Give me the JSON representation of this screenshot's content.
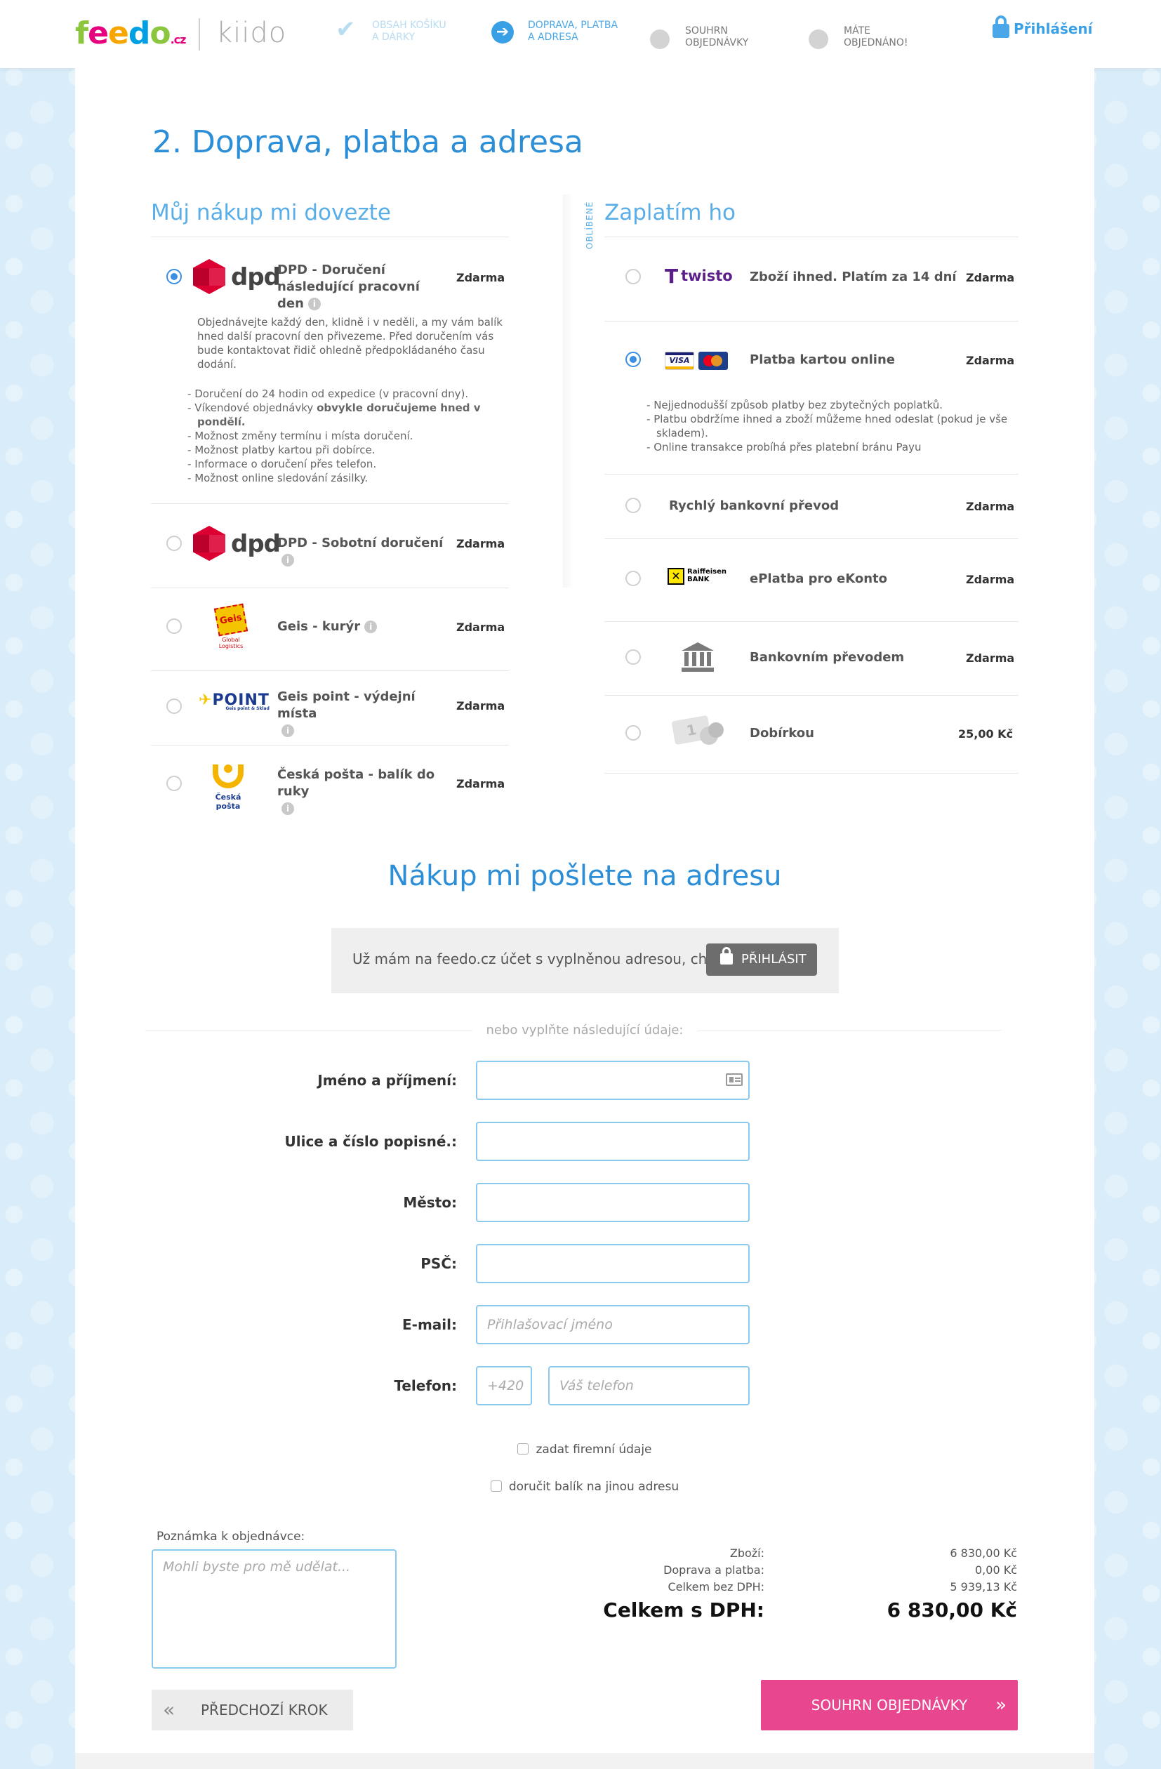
{
  "header": {
    "logo": "feedo.cz",
    "logo_secondary": "kiido",
    "steps": [
      {
        "label_line1": "OBSAH KOŠÍKU",
        "label_line2": "A DÁRKY",
        "state": "done"
      },
      {
        "label_line1": "DOPRAVA, PLATBA",
        "label_line2": "A ADRESA",
        "state": "active"
      },
      {
        "label_line1": "SOUHRN",
        "label_line2": "OBJEDNÁVKY",
        "state": "pending"
      },
      {
        "label_line1": "MÁTE",
        "label_line2": "OBJEDNÁNO!",
        "state": "pending"
      }
    ],
    "login_label": "Přihlášení"
  },
  "page": {
    "title": "2. Doprava, platba a adresa"
  },
  "delivery": {
    "title": "Můj nákup mi dovezte",
    "options": [
      {
        "logo": "dpd",
        "name": "DPD - Doručení následující pracovní den",
        "price": "Zdarma",
        "selected": true,
        "description": "Objednávejte každý den, klidně i v neděli, a my vám balík hned další pracovní den přivezeme. Před doručením vás bude kontaktovat řidič ohledně předpokládaného času dodání.",
        "bullets": [
          "Doručení do 24 hodin od expedice (v pracovní dny).",
          "Víkendové objednávky",
          "obvykle doručujeme hned v pondělí.",
          "Možnost změny termínu i místa doručení.",
          "Možnost platby kartou při dobírce.",
          "Informace o doručení přes telefon.",
          "Možnost online sledování zásilky."
        ]
      },
      {
        "logo": "dpd",
        "name": "DPD - Sobotní doručení",
        "price": "Zdarma",
        "selected": false
      },
      {
        "logo": "Geis",
        "logo_sub": "Global Logistics",
        "name": "Geis - kurýr",
        "price": "Zdarma",
        "selected": false
      },
      {
        "logo": "POINT",
        "logo_sub": "Geis point & Sklad",
        "name": "Geis point - výdejní místa",
        "price": "Zdarma",
        "selected": false
      },
      {
        "logo": "Česká pošta",
        "name": "Česká pošta - balík do ruky",
        "price": "Zdarma",
        "selected": false
      }
    ]
  },
  "payment": {
    "title": "Zaplatím ho",
    "favourite_label": "OBLÍBENÉ",
    "options": [
      {
        "logo": "twisto",
        "logo_mark": "T",
        "name": "Zboží ihned. Platím za 14 dní",
        "price": "Zdarma",
        "selected": false
      },
      {
        "logo_visa": "VISA",
        "name": "Platba kartou online",
        "price": "Zdarma",
        "selected": true,
        "bullets": [
          "Nejjednodušší způsob platby bez zbytečných poplatků.",
          "Platbu obdržíme ihned a zboží můžeme hned odeslat (pokud je vše skladem).",
          "Online transakce probíhá přes platební bránu Payu"
        ]
      },
      {
        "name": "Rychlý bankovní převod",
        "price": "Zdarma",
        "selected": false
      },
      {
        "logo_line1": "Raiffeisen",
        "logo_line2": "BANK",
        "name": "ePlatba pro eKonto",
        "price": "Zdarma",
        "selected": false
      },
      {
        "name": "Bankovním převodem",
        "price": "Zdarma",
        "selected": false
      },
      {
        "logo_note": "1",
        "name": "Dobírkou",
        "price": "25,00 Kč",
        "selected": false
      }
    ]
  },
  "address": {
    "title": "Nákup mi pošlete na adresu",
    "login_prompt": "Už mám na feedo.cz účet s vyplněnou adresou, chci se",
    "login_button": "PŘIHLÁSIT",
    "or_text": "nebo vyplňte následující údaje:",
    "fields": {
      "name_label": "Jméno a příjmení:",
      "street_label": "Ulice a číslo popisné.:",
      "city_label": "Město:",
      "zip_label": "PSČ:",
      "email_label": "E-mail:",
      "email_placeholder": "Přihlašovací jméno",
      "phone_label": "Telefon:",
      "phone_prefix": "+420",
      "phone_placeholder": "Váš telefon"
    },
    "company_checkbox": "zadat firemní údaje",
    "other_address_checkbox": "doručit balík na jinou adresu"
  },
  "note": {
    "label": "Poznámka k objednávce:",
    "placeholder": "Mohli byste pro mě udělat..."
  },
  "summary": {
    "goods_label": "Zboží:",
    "goods_value": "6 830,00 Kč",
    "shipping_label": "Doprava a platba:",
    "shipping_value": "0,00 Kč",
    "without_vat_label": "Celkem bez DPH:",
    "without_vat_value": "5 939,13 Kč",
    "total_label": "Celkem s DPH:",
    "total_value": "6 830,00 Kč"
  },
  "buttons": {
    "prev": "PŘEDCHOZÍ KROK",
    "next": "SOUHRN OBJEDNÁVKY"
  },
  "colors": {
    "accent": "#2b8ed6",
    "cta": "#e8468e",
    "input_border": "#8cc9ee"
  }
}
